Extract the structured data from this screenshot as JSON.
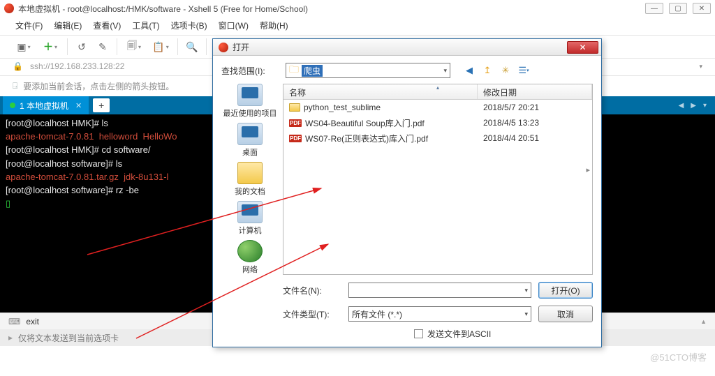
{
  "window": {
    "title": "本地虚拟机 - root@localhost:/HMK/software - Xshell 5 (Free for Home/School)"
  },
  "menu": {
    "file": "文件(F)",
    "edit": "编辑(E)",
    "view": "查看(V)",
    "tools": "工具(T)",
    "tabs": "选项卡(B)",
    "window": "窗口(W)",
    "help": "帮助(H)"
  },
  "address": {
    "url": "ssh://192.168.233.128:22"
  },
  "hint": {
    "text": "要添加当前会话，点击左侧的箭头按钮。"
  },
  "tab": {
    "label": "1 本地虚拟机"
  },
  "terminal": {
    "line1_prompt": "[root@localhost HMK]# ",
    "line1_cmd": "ls",
    "line2": "apache-tomcat-7.0.81  helloword  HelloWo",
    "line3_prompt": "[root@localhost HMK]# ",
    "line3_cmd": "cd software/",
    "line4_prompt": "[root@localhost software]# ",
    "line4_cmd": "ls",
    "line5": "apache-tomcat-7.0.81.tar.gz  jdk-8u131-l",
    "line6_prompt": "[root@localhost software]# ",
    "line6_cmd": "rz -be",
    "cursor": "▯"
  },
  "bottom": {
    "exit": "exit",
    "status": "仅将文本发送到当前选项卡"
  },
  "watermark": "@51CTO博客",
  "dialog": {
    "title": "打开",
    "lookin_label": "查找范围(I):",
    "lookin_value": "爬虫",
    "places": {
      "recent": "最近使用的项目",
      "desktop": "桌面",
      "documents": "我的文档",
      "computer": "计算机",
      "network": "网络"
    },
    "columns": {
      "name": "名称",
      "date": "修改日期"
    },
    "files": [
      {
        "icon": "folder",
        "name": "python_test_sublime",
        "date": "2018/5/7 20:21"
      },
      {
        "icon": "pdf",
        "name": "WS04-Beautiful Soup库入门.pdf",
        "date": "2018/4/5 13:23"
      },
      {
        "icon": "pdf",
        "name": "WS07-Re(正则表达式)库入门.pdf",
        "date": "2018/4/4 20:51"
      }
    ],
    "filename_label": "文件名(N):",
    "filename_value": "",
    "filetype_label": "文件类型(T):",
    "filetype_value": "所有文件 (*.*)",
    "open_btn": "打开(O)",
    "cancel_btn": "取消",
    "ascii_label": "发送文件到ASCII"
  }
}
